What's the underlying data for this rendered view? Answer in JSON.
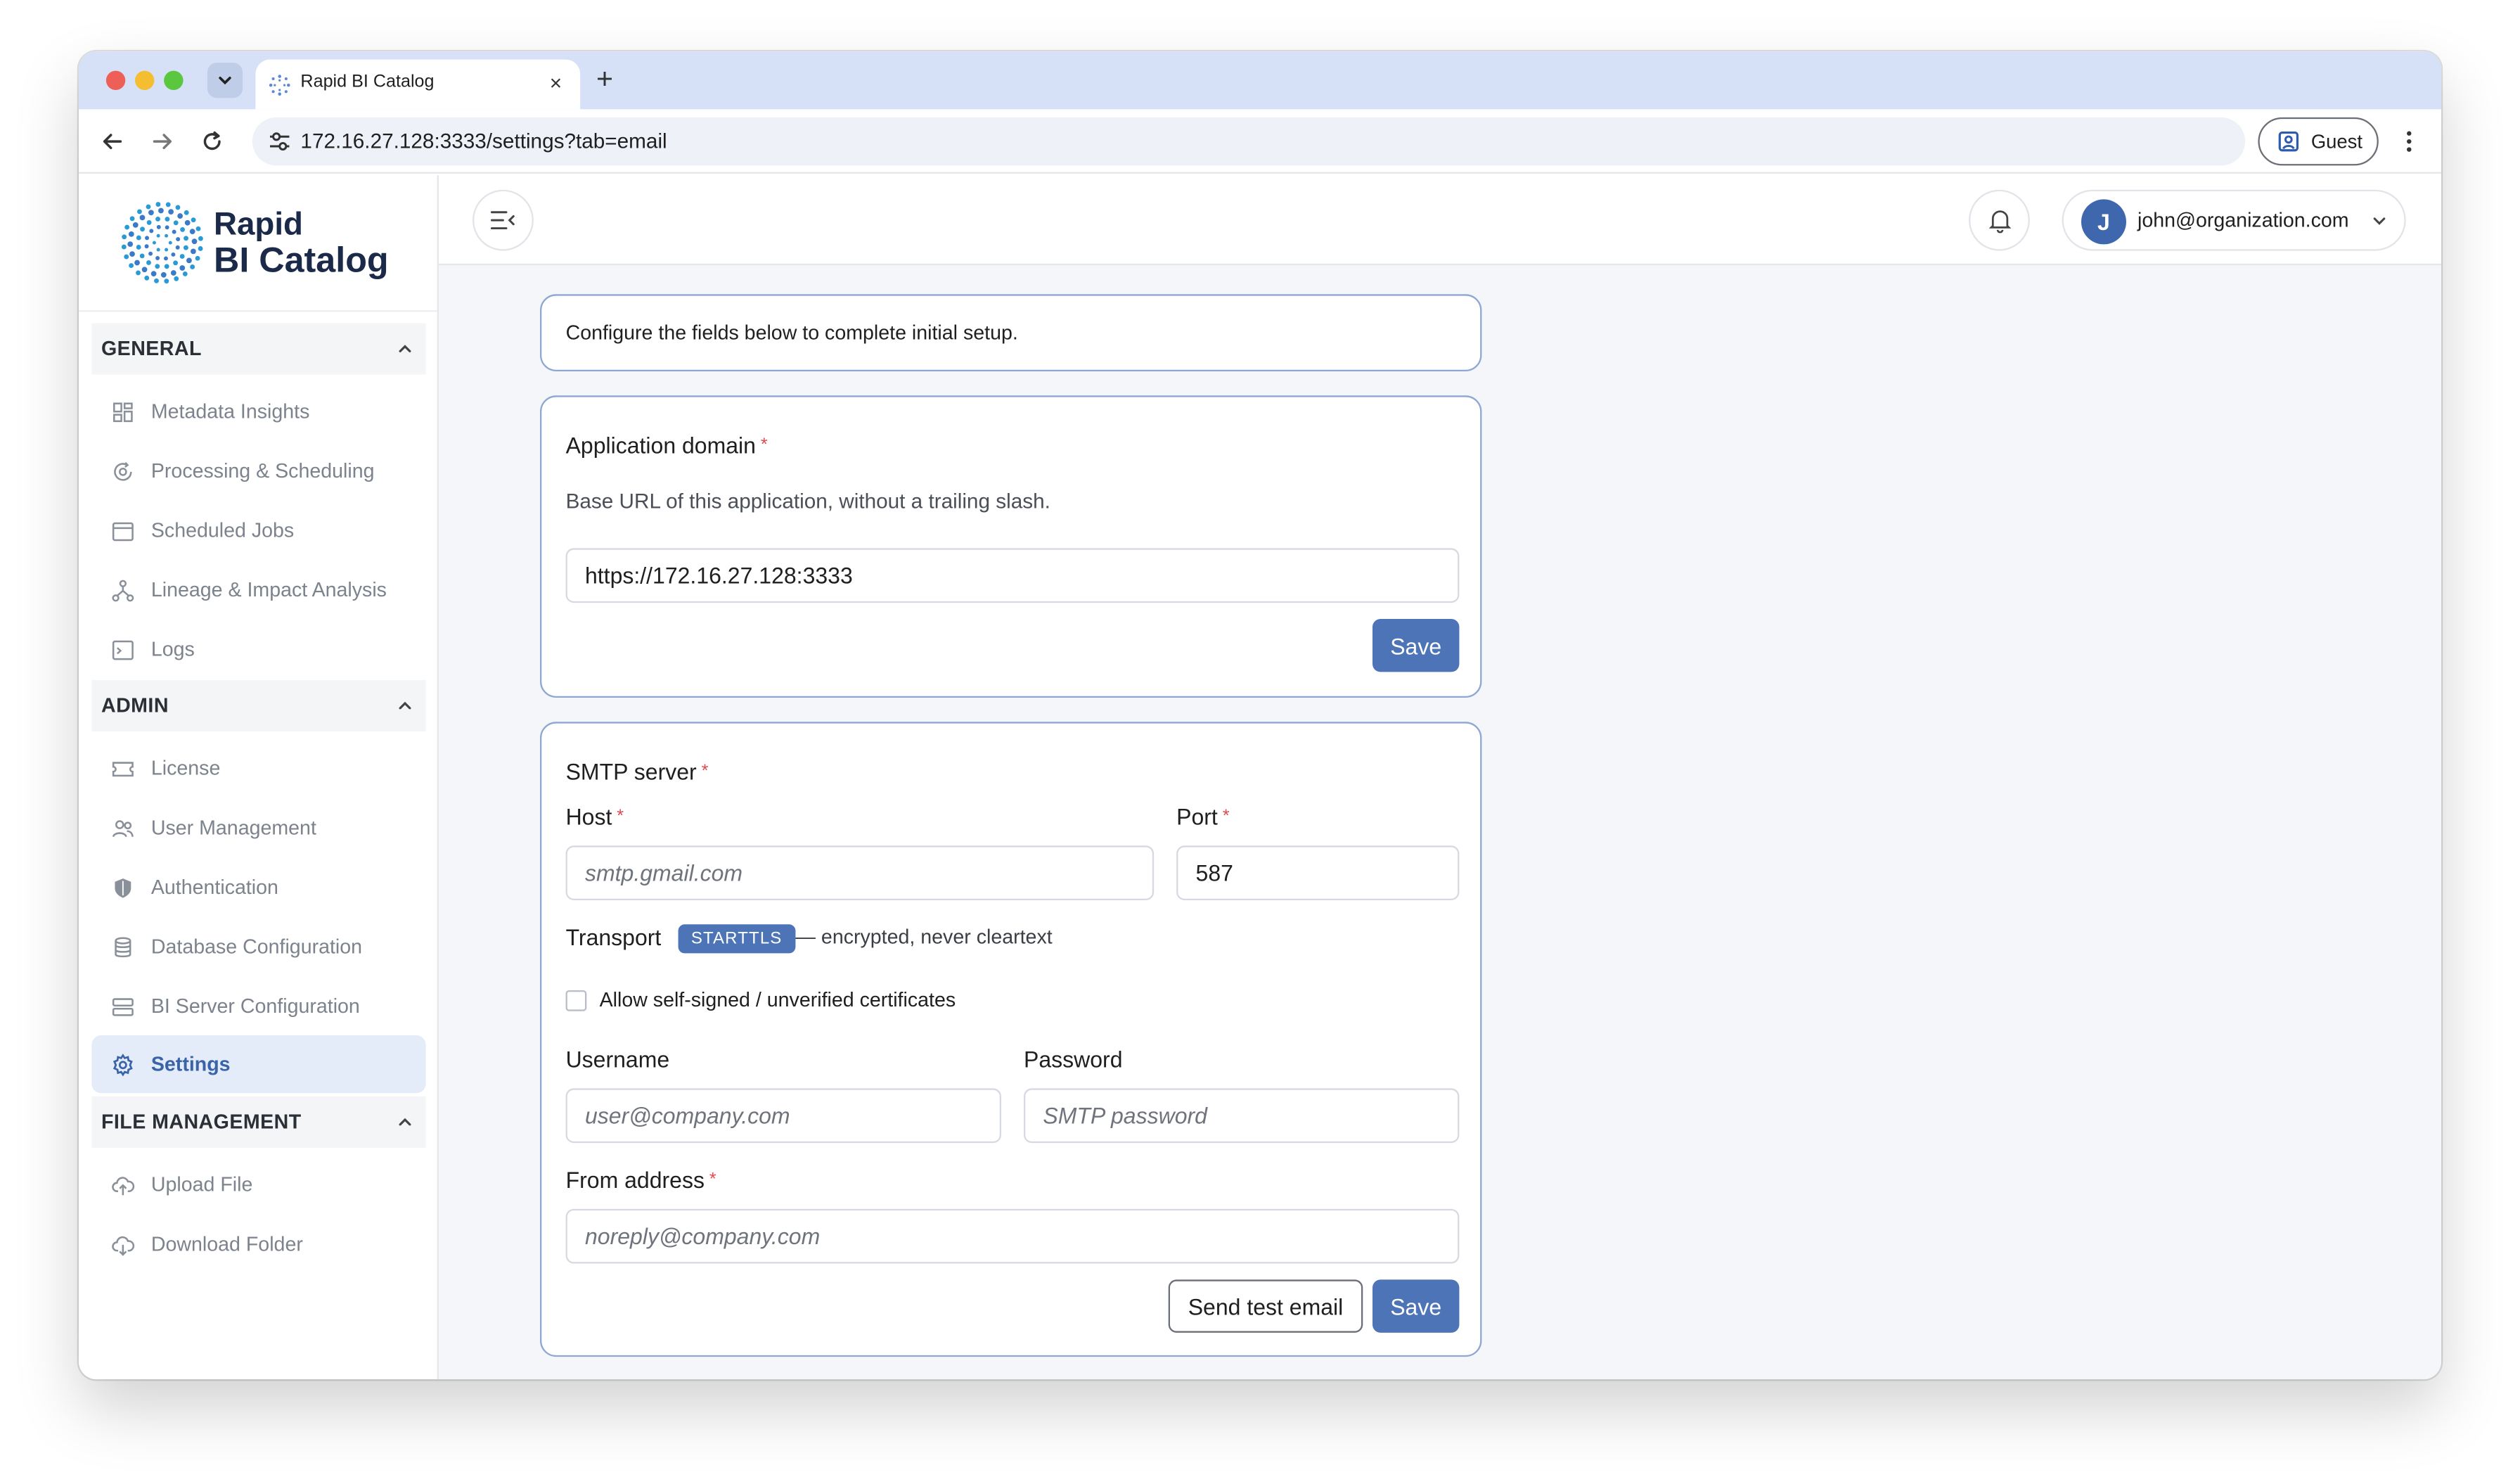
{
  "browser": {
    "tab_title": "Rapid BI Catalog",
    "tab_close": "×",
    "new_tab": "+",
    "url": "172.16.27.128:3333/settings?tab=email",
    "profile_label": "Guest"
  },
  "app": {
    "logo_line1": "Rapid",
    "logo_line2": "BI Catalog"
  },
  "sidebar": {
    "sections": [
      {
        "title": "GENERAL",
        "items": [
          "Metadata Insights",
          "Processing & Scheduling",
          "Scheduled Jobs",
          "Lineage & Impact Analysis",
          "Logs"
        ]
      },
      {
        "title": "ADMIN",
        "items": [
          "License",
          "User Management",
          "Authentication",
          "Database Configuration",
          "BI Server Configuration",
          "Settings"
        ]
      },
      {
        "title": "FILE MANAGEMENT",
        "items": [
          "Upload File",
          "Download Folder"
        ]
      }
    ],
    "active_item": "Settings"
  },
  "header": {
    "user_initial": "J",
    "user_email": "john@organization.com"
  },
  "intro": {
    "text": "Configure the fields below to complete initial setup."
  },
  "app_domain": {
    "label": "Application domain",
    "required_mark": "*",
    "help": "Base URL of this application, without a trailing slash.",
    "value": "https://172.16.27.128:3333",
    "save_label": "Save"
  },
  "smtp": {
    "title": "SMTP server",
    "required_mark": "*",
    "host_label": "Host",
    "host_placeholder": "smtp.gmail.com",
    "port_label": "Port",
    "port_value": "587",
    "transport_label": "Transport",
    "transport_badge": "STARTTLS",
    "transport_note": "— encrypted, never cleartext",
    "allow_self_signed_label": "Allow self-signed / unverified certificates",
    "allow_self_signed_checked": false,
    "username_label": "Username",
    "username_placeholder": "user@company.com",
    "password_label": "Password",
    "password_placeholder": "SMTP password",
    "from_label": "From address",
    "from_placeholder": "noreply@company.com",
    "test_label": "Send test email",
    "save_label": "Save"
  },
  "colors": {
    "primary": "#4c74b7",
    "card_border": "#8ea7d3",
    "active_bg": "#e4ecf9",
    "required": "#e5484d"
  }
}
